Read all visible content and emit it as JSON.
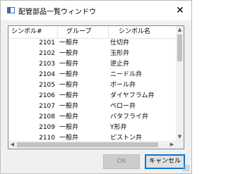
{
  "window": {
    "title": "配管部品一覧ウィンドウ",
    "close_glyph": "✕"
  },
  "table": {
    "columns": [
      "シンボル#",
      "グループ",
      "シンボル名"
    ],
    "rows": [
      {
        "symbol": "2101",
        "group": "一般弁",
        "name": "仕切弁"
      },
      {
        "symbol": "2102",
        "group": "一般弁",
        "name": "玉形弁"
      },
      {
        "symbol": "2103",
        "group": "一般弁",
        "name": "逆止弁"
      },
      {
        "symbol": "2104",
        "group": "一般弁",
        "name": "ニードル弁"
      },
      {
        "symbol": "2105",
        "group": "一般弁",
        "name": "ボール弁"
      },
      {
        "symbol": "2106",
        "group": "一般弁",
        "name": "ダイヤフラム弁"
      },
      {
        "symbol": "2107",
        "group": "一般弁",
        "name": "ペロー弁"
      },
      {
        "symbol": "2108",
        "group": "一般弁",
        "name": "バタフライ弁"
      },
      {
        "symbol": "2109",
        "group": "一般弁",
        "name": "Y形弁"
      },
      {
        "symbol": "2110",
        "group": "一般弁",
        "name": "ピストン弁"
      }
    ]
  },
  "buttons": {
    "ok": "OK",
    "cancel": "キャンセル"
  },
  "scroll_glyphs": {
    "up": "▲",
    "down": "▼",
    "left": "◀",
    "right": "▶"
  },
  "colors": {
    "accent": "#0078d7",
    "ok_disabled_bg": "#cccccc"
  }
}
